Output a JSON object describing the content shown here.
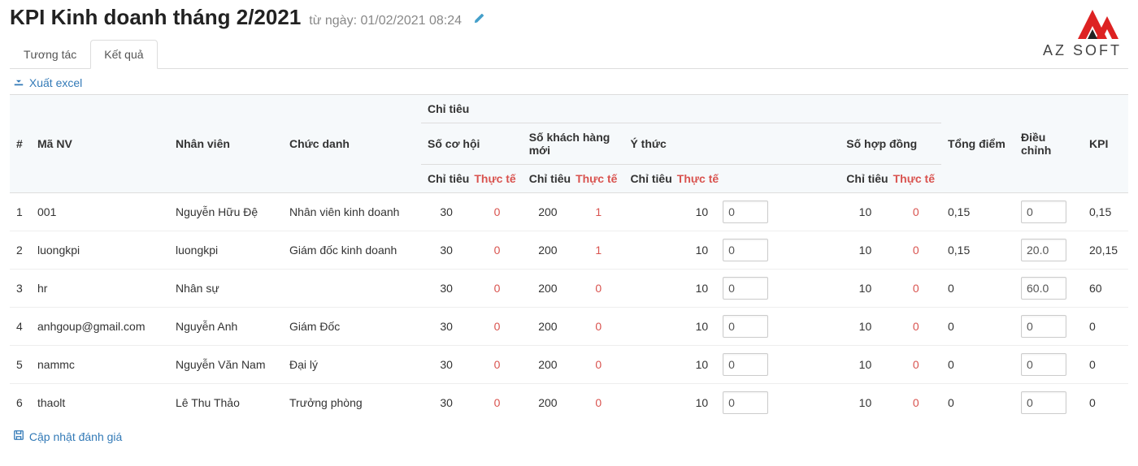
{
  "header": {
    "title": "KPI Kinh doanh tháng 2/2021",
    "subtitle": "từ ngày: 01/02/2021 08:24"
  },
  "logo_text": "AZ SOFT",
  "tabs": [
    {
      "label": "Tương tác",
      "active": false
    },
    {
      "label": "Kết quả",
      "active": true
    }
  ],
  "export_label": "Xuất excel",
  "save_label": "Cập nhật đánh giá",
  "columns": {
    "idx": "#",
    "ma_nv": "Mã NV",
    "nhan_vien": "Nhân viên",
    "chuc_danh": "Chức danh",
    "chi_tieu_group": "Chỉ tiêu",
    "tong_diem": "Tổng điểm",
    "dieu_chinh": "Điều chỉnh",
    "kpi": "KPI",
    "sub_chi_tieu": "Chỉ tiêu",
    "sub_thuc_te": "Thực tế",
    "groups": {
      "so_co_hoi": "Số cơ hội",
      "so_khach_hang_moi": "Số khách hàng mới",
      "y_thuc": "Ý thức",
      "so_hop_dong": "Số hợp đồng"
    }
  },
  "rows": [
    {
      "idx": "1",
      "ma_nv": "001",
      "nhan_vien": "Nguyễn Hữu Đệ",
      "chuc_danh": "Nhân viên kinh doanh",
      "so_co_hoi_ct": "30",
      "so_co_hoi_tt": "0",
      "so_khach_ct": "200",
      "so_khach_tt": "1",
      "y_thuc_ct": "10",
      "y_thuc_tt": "0",
      "so_hd_ct": "10",
      "so_hd_tt": "0",
      "tong_diem": "0,15",
      "dieu_chinh": "0",
      "kpi": "0,15"
    },
    {
      "idx": "2",
      "ma_nv": "luongkpi",
      "nhan_vien": "luongkpi",
      "chuc_danh": "Giám đốc kinh doanh",
      "so_co_hoi_ct": "30",
      "so_co_hoi_tt": "0",
      "so_khach_ct": "200",
      "so_khach_tt": "1",
      "y_thuc_ct": "10",
      "y_thuc_tt": "0",
      "so_hd_ct": "10",
      "so_hd_tt": "0",
      "tong_diem": "0,15",
      "dieu_chinh": "20.0",
      "kpi": "20,15"
    },
    {
      "idx": "3",
      "ma_nv": "hr",
      "nhan_vien": "Nhân sự",
      "chuc_danh": "",
      "so_co_hoi_ct": "30",
      "so_co_hoi_tt": "0",
      "so_khach_ct": "200",
      "so_khach_tt": "0",
      "y_thuc_ct": "10",
      "y_thuc_tt": "0",
      "so_hd_ct": "10",
      "so_hd_tt": "0",
      "tong_diem": "0",
      "dieu_chinh": "60.0",
      "kpi": "60"
    },
    {
      "idx": "4",
      "ma_nv": "anhgoup@gmail.com",
      "nhan_vien": "Nguyễn Anh",
      "chuc_danh": "Giám Đốc",
      "so_co_hoi_ct": "30",
      "so_co_hoi_tt": "0",
      "so_khach_ct": "200",
      "so_khach_tt": "0",
      "y_thuc_ct": "10",
      "y_thuc_tt": "0",
      "so_hd_ct": "10",
      "so_hd_tt": "0",
      "tong_diem": "0",
      "dieu_chinh": "0",
      "kpi": "0"
    },
    {
      "idx": "5",
      "ma_nv": "nammc",
      "nhan_vien": "Nguyễn Văn Nam",
      "chuc_danh": "Đại lý",
      "so_co_hoi_ct": "30",
      "so_co_hoi_tt": "0",
      "so_khach_ct": "200",
      "so_khach_tt": "0",
      "y_thuc_ct": "10",
      "y_thuc_tt": "0",
      "so_hd_ct": "10",
      "so_hd_tt": "0",
      "tong_diem": "0",
      "dieu_chinh": "0",
      "kpi": "0"
    },
    {
      "idx": "6",
      "ma_nv": "thaolt",
      "nhan_vien": "Lê Thu Thảo",
      "chuc_danh": "Trưởng phòng",
      "so_co_hoi_ct": "30",
      "so_co_hoi_tt": "0",
      "so_khach_ct": "200",
      "so_khach_tt": "0",
      "y_thuc_ct": "10",
      "y_thuc_tt": "0",
      "so_hd_ct": "10",
      "so_hd_tt": "0",
      "tong_diem": "0",
      "dieu_chinh": "0",
      "kpi": "0"
    }
  ]
}
